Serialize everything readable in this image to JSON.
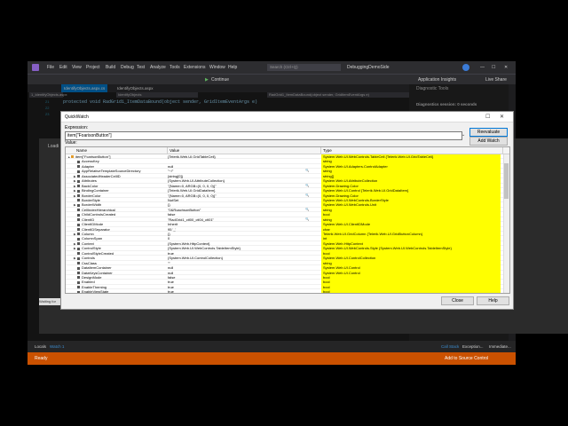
{
  "vs": {
    "menu": [
      "File",
      "Edit",
      "View",
      "Project",
      "Build",
      "Debug",
      "Test",
      "Analyze",
      "Tools",
      "Extensions",
      "Window",
      "Help"
    ],
    "search_placeholder": "Search (Ctrl+Q)",
    "solution_title": "DebuggingDemoSide",
    "app_insights": "Application Insights",
    "live_share": "Live Share",
    "continue_label": "Continue",
    "tabs": [
      "IdentifyObjects.aspx.cs",
      "IdentifyObjects.aspx"
    ],
    "left_tab": "1_IdentifyObjects.aspx",
    "object_dropdown": "IdentifyObjects",
    "method_dropdown": "RadGrid1_ItemDataBound(object sender, GridItemEventArgs e)",
    "code_line": "protected void RadGrid1_ItemDataBound(object sender, GridItemEventArgs e)",
    "line_numbers": [
      "21",
      "22",
      "23"
    ],
    "diag_title": "Diagnostic Tools",
    "diag_session": "Diagnostics session: 0 seconds",
    "bottom_tabs": [
      "Locals",
      "Watch 1"
    ],
    "bottom_right_tabs": [
      "Call Stack",
      "Exception...",
      "Immediate..."
    ],
    "status_ready": "Ready",
    "status_source": "Add to Source Control"
  },
  "browser": {
    "text": "Waiting for lo...",
    "tab": "Loadi"
  },
  "quickwatch": {
    "title": "QuickWatch",
    "expression_label": "Expression:",
    "expression_value": "item[\"FoarisonButton\"]",
    "reevaluate_label": "Reevaluate",
    "add_watch_label": "Add Watch",
    "value_label": "Value:",
    "columns": {
      "name": "Name",
      "value": "Value",
      "type": "Type"
    },
    "rows": [
      {
        "name": "item[\"FcarisonButton\"]",
        "value": "{Telerik.Web.UI.GridTableCell}",
        "type": "System.Web.UI.WebControls.TableCell {Telerik.Web.UI.GridTableCell}",
        "level": 0,
        "exp": "▲"
      },
      {
        "name": "AccessKey",
        "value": "",
        "type": "string",
        "level": 1,
        "exp": ""
      },
      {
        "name": "Adapter",
        "value": "null",
        "type": "System.Web.UI.Adapters.ControlAdapter",
        "level": 1,
        "exp": ""
      },
      {
        "name": "AppRelativeTemplateSourceDirectory",
        "value": "\"~/\"",
        "type": "string",
        "level": 1,
        "exp": ""
      },
      {
        "name": "AssociatedHeaderCellID",
        "value": "{string[0]}",
        "type": "string[]",
        "level": 1,
        "exp": "▶"
      },
      {
        "name": "Attributes",
        "value": "{System.Web.UI.AttributeCollection}",
        "type": "System.Web.UI.AttributeCollection",
        "level": 1,
        "exp": "▶"
      },
      {
        "name": "BackColor",
        "value": "\"{Name=0, ARGB=(0, 0, 0, 0)}\"",
        "type": "System.Drawing.Color",
        "level": 1,
        "exp": "▶"
      },
      {
        "name": "BindingContainer",
        "value": "{Telerik.Web.UI.GridDataItem}",
        "type": "System.Web.UI.Control {Telerik.Web.UI.GridDataItem}",
        "level": 1,
        "exp": "▶"
      },
      {
        "name": "BorderColor",
        "value": "\"{Name=0, ARGB=(0, 0, 0, 0)}\"",
        "type": "System.Drawing.Color",
        "level": 1,
        "exp": "▶"
      },
      {
        "name": "BorderStyle",
        "value": "NotSet",
        "type": "System.Web.UI.WebControls.BorderStyle",
        "level": 1,
        "exp": ""
      },
      {
        "name": "BorderWidth",
        "value": "{}",
        "type": "System.Web.UI.WebControls.Unit",
        "level": 1,
        "exp": "▶"
      },
      {
        "name": "CellIndexHierarchical",
        "value": "\"0&RoachsonButton\"",
        "type": "string",
        "level": 1,
        "exp": ""
      },
      {
        "name": "ChildControlsCreated",
        "value": "false",
        "type": "bool",
        "level": 1,
        "exp": ""
      },
      {
        "name": "ClientID",
        "value": "\"RadGrid1_ctl00_ctl04_ctl01\"",
        "type": "string",
        "level": 1,
        "exp": ""
      },
      {
        "name": "ClientIDMode",
        "value": "Inherit",
        "type": "System.Web.UI.ClientIDMode",
        "level": 1,
        "exp": ""
      },
      {
        "name": "ClientIDSeparator",
        "value": "95 '_'",
        "type": "char",
        "level": 1,
        "exp": ""
      },
      {
        "name": "Column",
        "value": "{}",
        "type": "Telerik.Web.UI.GridColumn {Telerik.Web.UI.GridButtonColumn}",
        "level": 1,
        "exp": "▶"
      },
      {
        "name": "ColumnSpan",
        "value": "0",
        "type": "int",
        "level": 1,
        "exp": ""
      },
      {
        "name": "Context",
        "value": "{System.Web.HttpContext}",
        "type": "System.Web.HttpContext",
        "level": 1,
        "exp": "▶"
      },
      {
        "name": "ControlStyle",
        "value": "{System.Web.UI.WebControls.TableItemStyle}",
        "type": "System.Web.UI.WebControls.Style {System.Web.UI.WebControls.TableItemStyle}",
        "level": 1,
        "exp": "▶"
      },
      {
        "name": "ControlStyleCreated",
        "value": "true",
        "type": "bool",
        "level": 1,
        "exp": ""
      },
      {
        "name": "Controls",
        "value": "{System.Web.UI.ControlCollection}",
        "type": "System.Web.UI.ControlCollection",
        "level": 1,
        "exp": "▶"
      },
      {
        "name": "CssClass",
        "value": "\"\"",
        "type": "string",
        "level": 1,
        "exp": ""
      },
      {
        "name": "DataItemContainer",
        "value": "null",
        "type": "System.Web.UI.Control",
        "level": 1,
        "exp": ""
      },
      {
        "name": "DataKeysContainer",
        "value": "null",
        "type": "System.Web.UI.Control",
        "level": 1,
        "exp": ""
      },
      {
        "name": "DesignMode",
        "value": "false",
        "type": "bool",
        "level": 1,
        "exp": ""
      },
      {
        "name": "Enabled",
        "value": "true",
        "type": "bool",
        "level": 1,
        "exp": ""
      },
      {
        "name": "EnableTheming",
        "value": "true",
        "type": "bool",
        "level": 1,
        "exp": ""
      },
      {
        "name": "EnableViewState",
        "value": "true",
        "type": "bool",
        "level": 1,
        "exp": ""
      }
    ],
    "close_label": "Close",
    "help_label": "Help"
  },
  "colors": {
    "type_highlight": "#ffff00",
    "status_bar": "#ca5100",
    "vs_dark": "#1e1e1e"
  }
}
